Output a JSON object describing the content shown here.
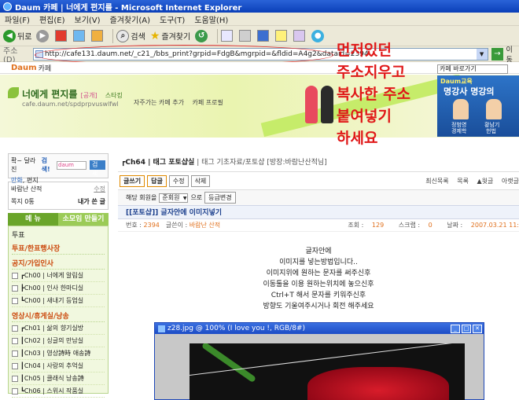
{
  "window": {
    "title": "Daum 카페 | 너에게 편지를 - Microsoft Internet Explorer"
  },
  "menu": [
    "파일(F)",
    "편집(E)",
    "보기(V)",
    "즐겨찾기(A)",
    "도구(T)",
    "도움말(H)"
  ],
  "toolbar": {
    "back": "뒤로",
    "search": "검색",
    "favorites": "즐겨찾기"
  },
  "address": {
    "label": "주소(D)",
    "url": "http://cafe131.daum.net/_c21_/bbs_print?grpid=FdgB&mgrpid=&fldid=A4g2&dataid=2394",
    "go_label": "이동"
  },
  "daum": {
    "logo_daum": "Daum",
    "logo_cafe": "카페"
  },
  "cafe": {
    "name": "너에게 편지를",
    "badge": "[공개]",
    "url": "cafe.daum.net/spdprpvuswlfwl",
    "link1": "자주가는 카페 추가",
    "link2": "카페 프로필",
    "star": "스타킹",
    "jump_select": "카페 바로가기"
  },
  "ad": {
    "top": "Daum교육",
    "main": "명강사 명강의",
    "name1": "정범영",
    "name2": "황남기",
    "sub1": "경제학",
    "sub2": "헌법"
  },
  "annotation": {
    "line1": "먼저있던",
    "line2": "주소지우고",
    "line3": "복사한 주소",
    "line4": "붙여넣기",
    "line5": "하세요"
  },
  "sidebar": {
    "search_hint": "확~ 달라진",
    "search_label": "검색!",
    "search_placeholder": "daum",
    "search_button": "검색",
    "link_mange": "만화",
    "link_pyeonji": "편지",
    "user_name": "바람난 산적",
    "edit": "수정",
    "note": "쪽지 0통",
    "writing": "내가 쓴 글",
    "tab_menu": "메 뉴",
    "tab_small": "소모임 만들기",
    "poll": "투표",
    "category0": "투표/한표행사장",
    "category1": "공지/가입인사",
    "items1": [
      "┏Ch00 | 너에게 알림실",
      "┣Ch00 | 인사 한마디실",
      "┗Ch00 | 새내기 등업실"
    ],
    "category2": "영상시/휴게실/낭송",
    "items2": [
      "┏Ch01 | 삶의 향기실방",
      "┃Ch02 | 싱글의 만남실",
      "┃Ch03 | 영상詩時 애송詩",
      "┃Ch04 | 사랑의 추억실",
      "┃Ch05 | 클래식 낭송詩",
      "┗Ch06 | 스위시 작품실"
    ]
  },
  "post": {
    "board": "┏Ch64 | 태그 포토샵실",
    "board_meta": "| 태그 기초자료/포토샵 [방장:바람난산적님]",
    "btn_write": "글쓰기",
    "btn_reply": "답글",
    "btn_edit": "수정",
    "btn_delete": "삭제",
    "nav_recent": "최신목록",
    "nav_list": "목록",
    "nav_prev": "▲윗글",
    "nav_next": "아랫글",
    "member_label": "해당 회원을",
    "member_select": "준회원",
    "member_to": "으로",
    "member_btn": "등급변경",
    "title": "[[포토샵]] 글자안에 이미지넣기",
    "number_label": "번호",
    "number": "2394",
    "author_label": "글쓴이",
    "author": "바람난 산적",
    "views_label": "조회",
    "views": "129",
    "scrap_label": "스크랩",
    "scrap": "0",
    "date_label": "날짜",
    "date": "2007.03.21 11:",
    "body": [
      "글자안에",
      "이미지를 넣는방법입니다..",
      "이미지위에 원하는 문자를 써주신후",
      "이동툴을 이용 원하는위치에 놓으신후",
      "Ctrl+T 해서 문자를 키워주신후",
      "방향도 기울여주시거나 회전 해주세요"
    ]
  },
  "photoshop": {
    "title": "z28.jpg @ 100% (I love you !, RGB/8#)"
  }
}
